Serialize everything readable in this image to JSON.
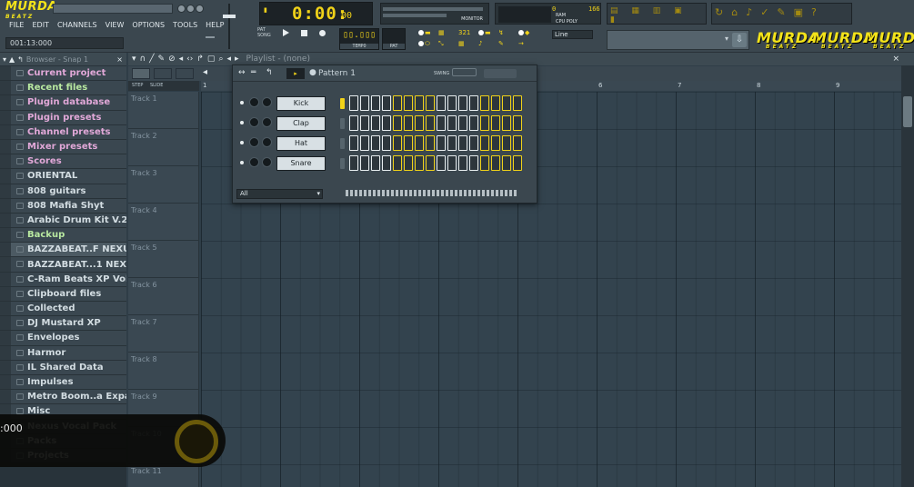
{
  "app": {
    "logo_text": "MURDA",
    "logo_sub": "BEATZ",
    "menu": [
      "FILE",
      "EDIT",
      "CHANNELS",
      "VIEW",
      "OPTIONS",
      "TOOLS",
      "HELP"
    ],
    "time_display": "001:13:000",
    "song_time": "0:00:",
    "song_time_ms": "00",
    "tempo_label": "TEMPO",
    "pat_label": "PAT",
    "monitor_label": "MONITOR",
    "cpu_label": "CPU",
    "poly_label": "POLY",
    "ram_label": "RAM",
    "cpu_value": "0",
    "ram_value": "166",
    "snap_value": "Line",
    "pattern_counter": "321",
    "brand_logos": [
      "MURDA",
      "MURDA",
      "MURDA"
    ],
    "brand_sub": "BEATZ",
    "accent_color": "#f0d219"
  },
  "browser": {
    "title": "Browser - Snap 1",
    "items": [
      {
        "label": "Current project",
        "style": "pink"
      },
      {
        "label": "Recent files",
        "style": "green"
      },
      {
        "label": "Plugin database",
        "style": "pink"
      },
      {
        "label": "Plugin presets",
        "style": "pink"
      },
      {
        "label": "Channel presets",
        "style": "pink"
      },
      {
        "label": "Mixer presets",
        "style": "pink"
      },
      {
        "label": "Scores",
        "style": "pink"
      },
      {
        "label": "ORIENTAL",
        "style": "plain"
      },
      {
        "label": "808 guitars",
        "style": "plain"
      },
      {
        "label": "808 Mafia Shyt",
        "style": "plain"
      },
      {
        "label": "Arabic Drum Kit V.2",
        "style": "plain"
      },
      {
        "label": "Backup",
        "style": "green"
      },
      {
        "label": "BAZZABEAT..F NEXUS XP",
        "style": "sel"
      },
      {
        "label": "BAZZABEAT...1 NEXUS XP",
        "style": "plain"
      },
      {
        "label": "C-Ram Beats XP Vol. 1",
        "style": "plain"
      },
      {
        "label": "Clipboard files",
        "style": "plain"
      },
      {
        "label": "Collected",
        "style": "plain"
      },
      {
        "label": "DJ Mustard XP",
        "style": "plain"
      },
      {
        "label": "Envelopes",
        "style": "plain"
      },
      {
        "label": "Harmor",
        "style": "plain"
      },
      {
        "label": "IL Shared Data",
        "style": "plain"
      },
      {
        "label": "Impulses",
        "style": "plain"
      },
      {
        "label": "Metro Boom..a Expansion",
        "style": "plain"
      },
      {
        "label": "Misc",
        "style": "plain"
      },
      {
        "label": "Nexus Vocal Pack",
        "style": "plain"
      },
      {
        "label": "Packs",
        "style": "plain"
      },
      {
        "label": "Projects",
        "style": "plain"
      }
    ]
  },
  "playlist": {
    "title": "Playlist - (none)",
    "step_label": "STEP",
    "slide_label": "SLIDE",
    "ruler": [
      "1",
      "2",
      "3",
      "4",
      "5",
      "6",
      "7",
      "8",
      "9"
    ],
    "tracks": [
      "Track 1",
      "Track 2",
      "Track 3",
      "Track 4",
      "Track 5",
      "Track 6",
      "Track 7",
      "Track 8",
      "Track 9",
      "Track 10",
      "Track 11"
    ]
  },
  "channel_rack": {
    "pattern": "Pattern 1",
    "swing_label": "SWING",
    "filter": "All",
    "channels": [
      {
        "name": "Kick",
        "selected": true
      },
      {
        "name": "Clap",
        "selected": false
      },
      {
        "name": "Hat",
        "selected": false
      },
      {
        "name": "Snare",
        "selected": false
      }
    ],
    "step_groups": [
      false,
      false,
      false,
      false,
      true,
      true,
      true,
      true,
      false,
      false,
      false,
      false,
      true,
      true,
      true,
      true
    ]
  },
  "overlay": {
    "value": ":000"
  }
}
